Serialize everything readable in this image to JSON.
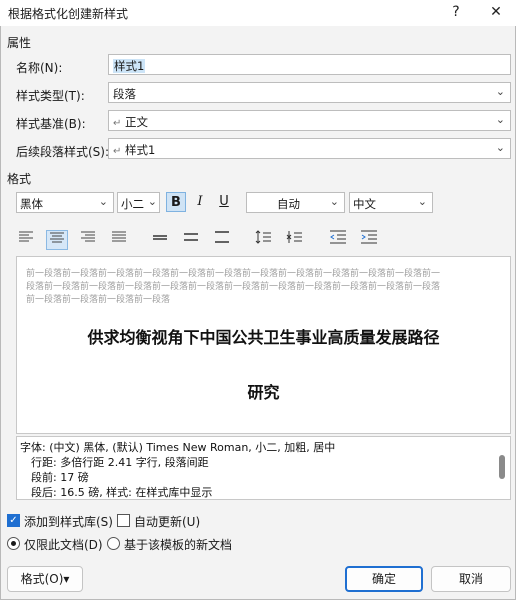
{
  "window": {
    "title": "根据格式化创建新样式",
    "help": "?",
    "close": "✕"
  },
  "properties": {
    "section_label": "属性",
    "name_label": "名称(N):",
    "name_value": "样式1",
    "type_label": "样式类型(T):",
    "type_value": "段落",
    "based_label": "样式基准(B):",
    "based_value": "正文",
    "next_label": "后续段落样式(S):",
    "next_value": "样式1",
    "para_mark": "↵"
  },
  "format": {
    "section_label": "格式",
    "font": "黑体",
    "size": "小二",
    "bold": "B",
    "italic": "I",
    "underline": "U",
    "color": "自动",
    "lang": "中文"
  },
  "preview": {
    "prev_para_line1": "前一段落前一段落前一段落前一段落前一段落前一段落前一段落前一段落前一段落前一段落前一段落前一",
    "prev_para_line2": "段落前一段落前一段落前一段落前一段落前一段落前一段落前一段落前一段落前一段落前一段落前一段落",
    "prev_para_line3": "前一段落前一段落前一段落前一段落",
    "title_line1": "供求均衡视角下中国公共卫生事业高质量发展路径",
    "title_line2": "研究"
  },
  "description": {
    "line1": "字体: (中文) 黑体, (默认) Times New Roman, 小二, 加粗, 居中",
    "line2": "行距: 多倍行距 2.41 字行, 段落间距",
    "line3": "段前: 17 磅",
    "line4": "段后: 16.5 磅, 样式: 在样式库中显示"
  },
  "options": {
    "add_to_gallery": "添加到样式库(S)",
    "auto_update": "自动更新(U)",
    "this_doc_only": "仅限此文档(D)",
    "new_docs": "基于该模板的新文档"
  },
  "buttons": {
    "format": "格式(O)▾",
    "ok": "确定",
    "cancel": "取消"
  }
}
